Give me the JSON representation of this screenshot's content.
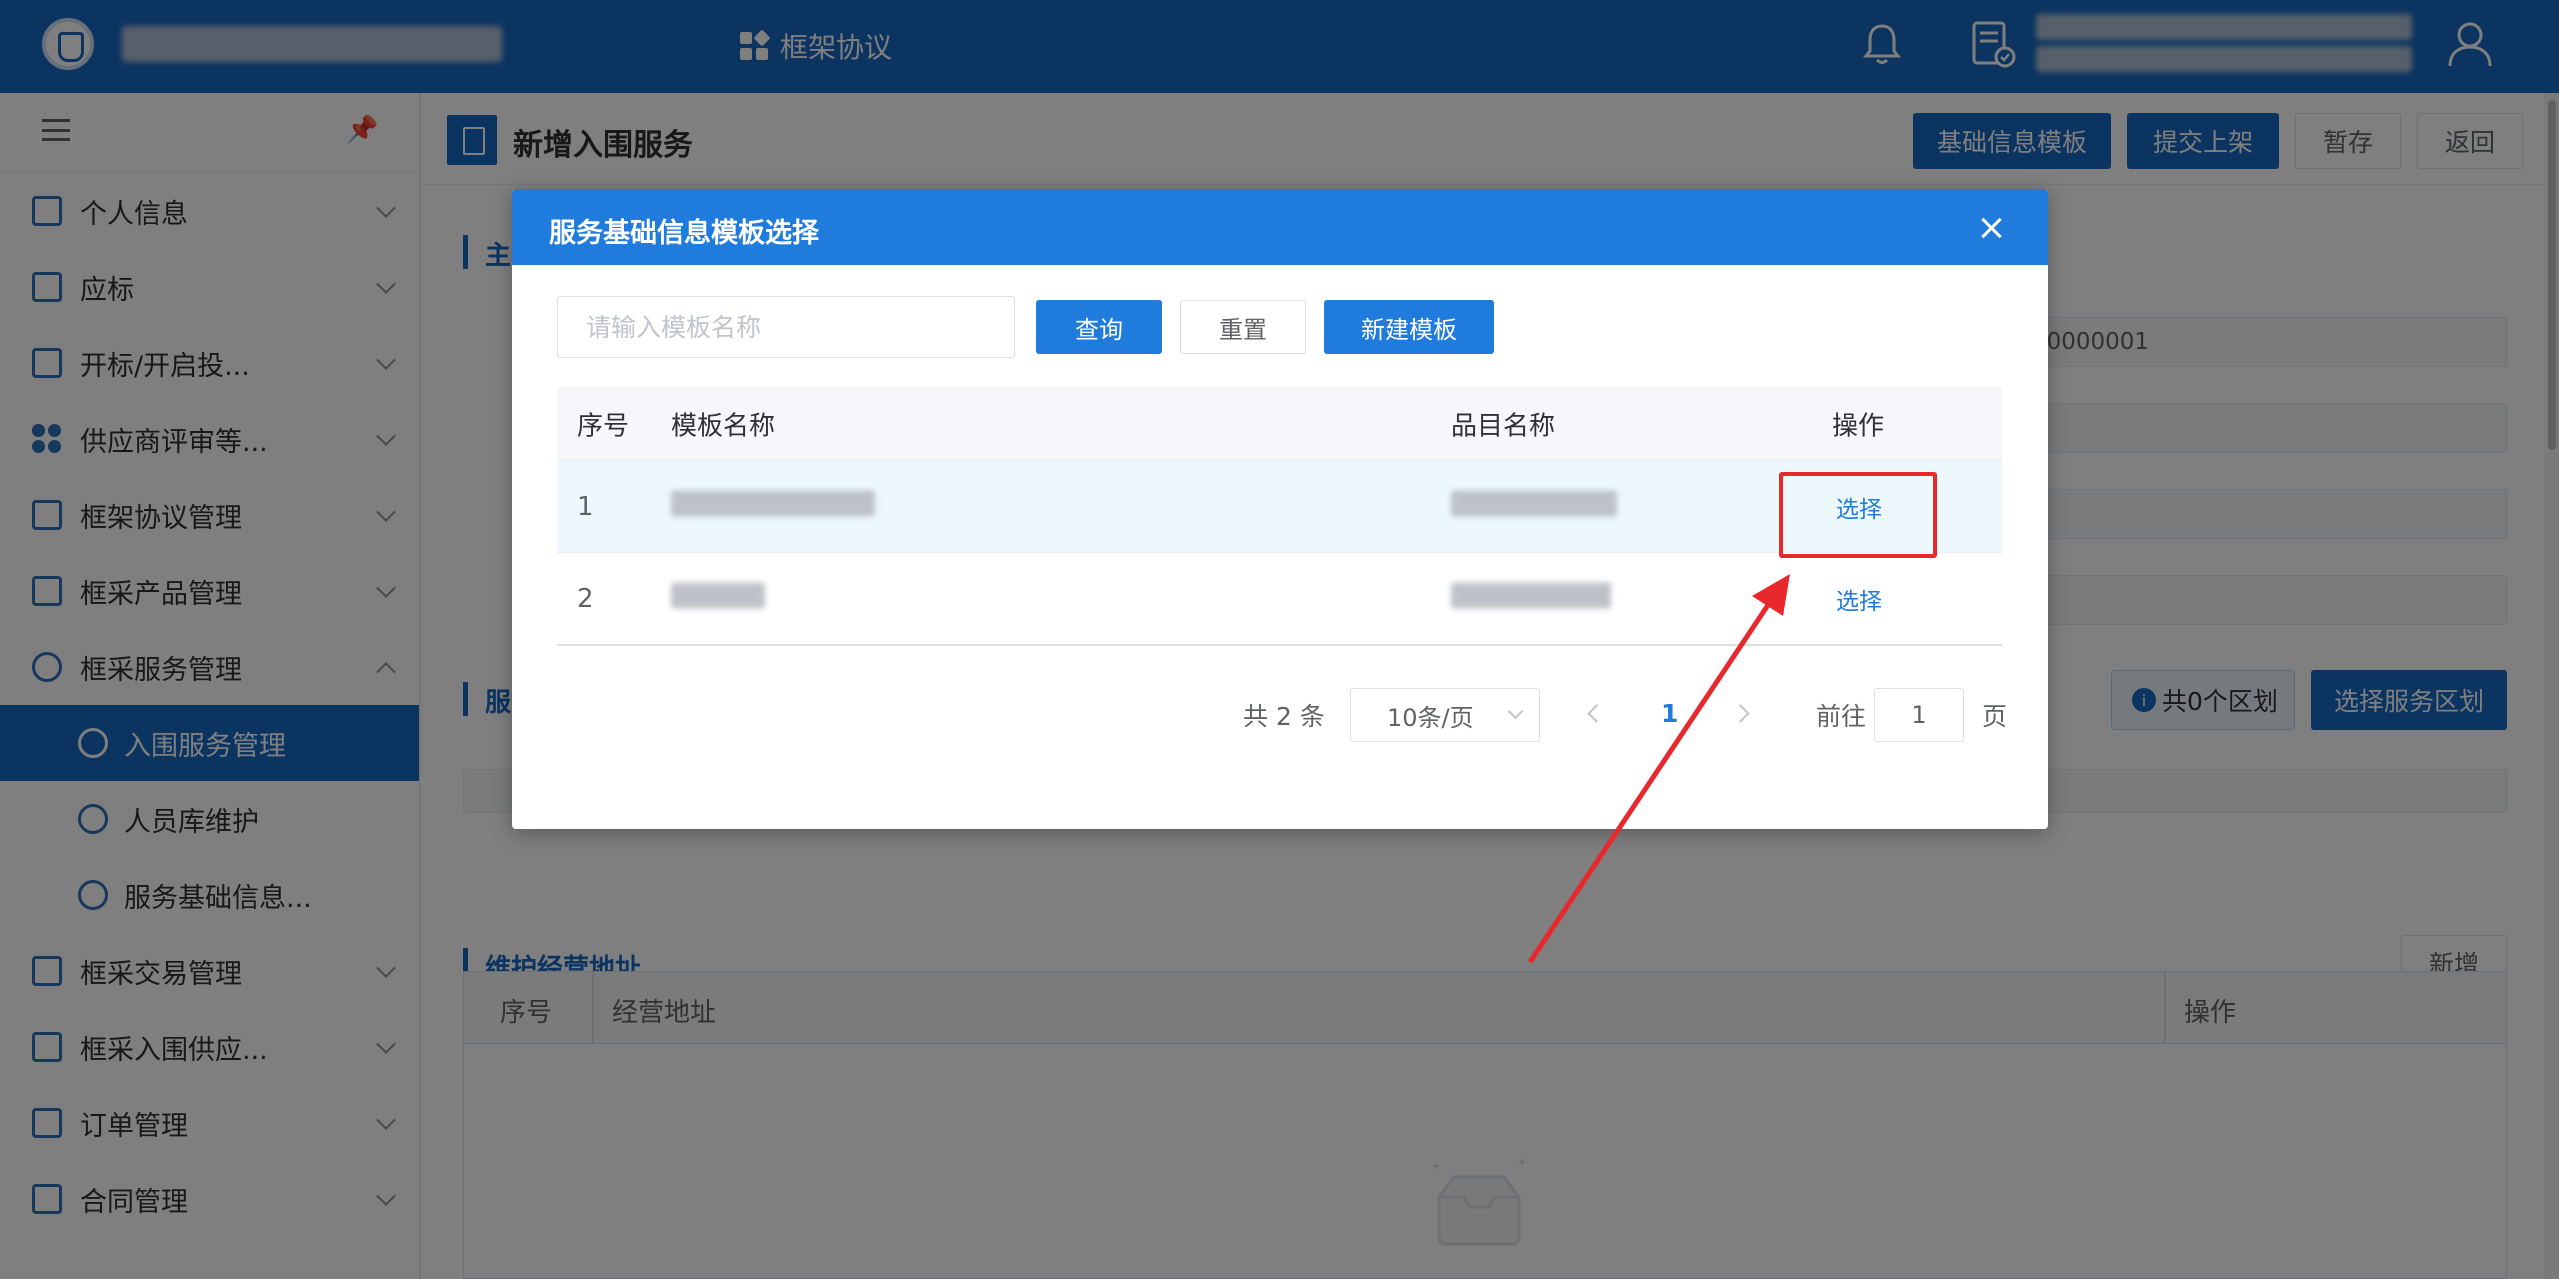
{
  "header": {
    "nav_label": "框架协议"
  },
  "sidebar": {
    "items": [
      {
        "label": "个人信息",
        "icon": "id-card-icon"
      },
      {
        "label": "应标",
        "icon": "bid-icon"
      },
      {
        "label": "开标/开启投...",
        "icon": "open-bid-icon"
      },
      {
        "label": "供应商评审等...",
        "icon": "grid-dots-icon"
      },
      {
        "label": "框架协议管理",
        "icon": "agreement-icon"
      },
      {
        "label": "框采产品管理",
        "icon": "product-icon"
      },
      {
        "label": "框采服务管理",
        "icon": "heart-hand-icon",
        "expanded": true
      }
    ],
    "sub_items": [
      {
        "label": "入围服务管理",
        "active": true
      },
      {
        "label": "人员库维护",
        "active": false
      },
      {
        "label": "服务基础信息...",
        "active": false
      }
    ],
    "items_after": [
      {
        "label": "框采交易管理",
        "icon": "trade-icon"
      },
      {
        "label": "框采入围供应...",
        "icon": "supplier-icon"
      },
      {
        "label": "订单管理",
        "icon": "order-icon"
      },
      {
        "label": "合同管理",
        "icon": "contract-icon"
      }
    ]
  },
  "page": {
    "title": "新增入围服务",
    "buttons": {
      "template": "基础信息模板",
      "submit": "提交上架",
      "draft": "暂存",
      "back": "返回"
    },
    "section_main_partial": "主",
    "section_service_partial": "服",
    "field_code_partial": "00000001",
    "region_badge": "共0个区划",
    "select_region_button": "选择服务区划",
    "address_section": "维护经营地址",
    "add_button": "新增",
    "address_table": {
      "columns": [
        "序号",
        "经营地址",
        "操作"
      ]
    }
  },
  "dialog": {
    "title": "服务基础信息模板选择",
    "search_placeholder": "请输入模板名称",
    "buttons": {
      "query": "查询",
      "reset": "重置",
      "new_template": "新建模板"
    },
    "table": {
      "columns": [
        "序号",
        "模板名称",
        "品目名称",
        "操作"
      ],
      "rows": [
        {
          "index": "1",
          "action": "选择"
        },
        {
          "index": "2",
          "action": "选择"
        }
      ]
    },
    "pagination": {
      "total": "共 2 条",
      "page_size": "10条/页",
      "current_page": "1",
      "goto_label": "前往",
      "goto_value": "1",
      "page_suffix": "页"
    }
  },
  "colors": {
    "brand": "#1769c2",
    "dialog_header": "#1f7bdc",
    "annotation": "#e8282b"
  }
}
